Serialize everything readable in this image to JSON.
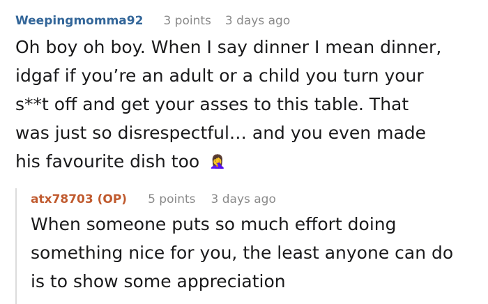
{
  "comments": [
    {
      "author": "Weepingmomma92",
      "points": "3 points",
      "time": "3 days ago",
      "lines": [
        "Oh boy oh boy. When I say dinner I mean dinner,",
        "idgaf if you’re an adult or a child you turn your",
        "s**t off and get your asses to this table. That",
        "was just so disrespectful… and you even made",
        "his favourite dish too"
      ],
      "emoji": "🤦‍♀️",
      "emoji_icon": "woman-facepalming-icon"
    },
    {
      "author": "atx78703 (OP)",
      "points": "5 points",
      "time": "3 days ago",
      "lines": [
        "When someone puts so much effort doing",
        "something nice for you, the least anyone can do",
        "is to show some appreciation"
      ]
    }
  ]
}
